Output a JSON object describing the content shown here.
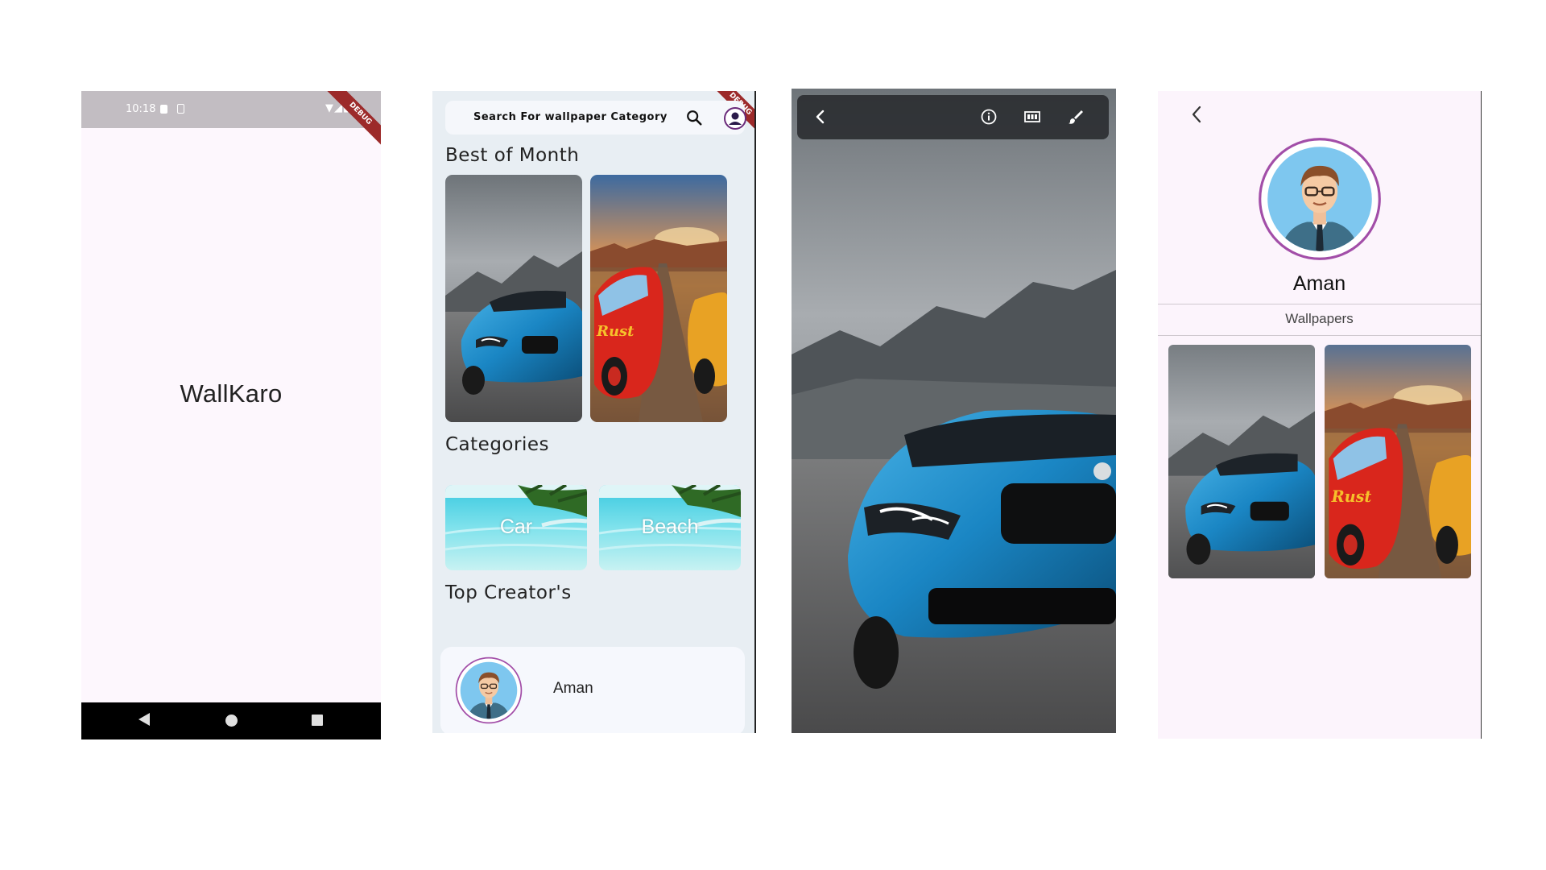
{
  "splash": {
    "status_time": "10:18",
    "debug_label": "DEBUG",
    "app_name": "WallKaro"
  },
  "home": {
    "debug_label": "DEBUG",
    "search_placeholder": "Search For wallpaper Category",
    "best_of_month_title": "Best of Month",
    "categories_title": "Categories",
    "categories": [
      {
        "label": "Car"
      },
      {
        "label": "Beach"
      }
    ],
    "top_creators_title": "Top Creator's",
    "creators": [
      {
        "name": "Aman"
      }
    ]
  },
  "viewer": {
    "actions": [
      "back-icon",
      "info-icon",
      "grid-icon",
      "brush-icon"
    ]
  },
  "profile": {
    "name": "Aman",
    "section_label": "Wallpapers"
  },
  "colors": {
    "splash_bg": "#fdf7fd",
    "home_bg": "#e8eef3",
    "profile_bg": "#fcf4fc",
    "avatar_ring": "#a24ea8",
    "avatar_bg": "#7ec7ef",
    "debug_ribbon": "#9c2a2a"
  }
}
